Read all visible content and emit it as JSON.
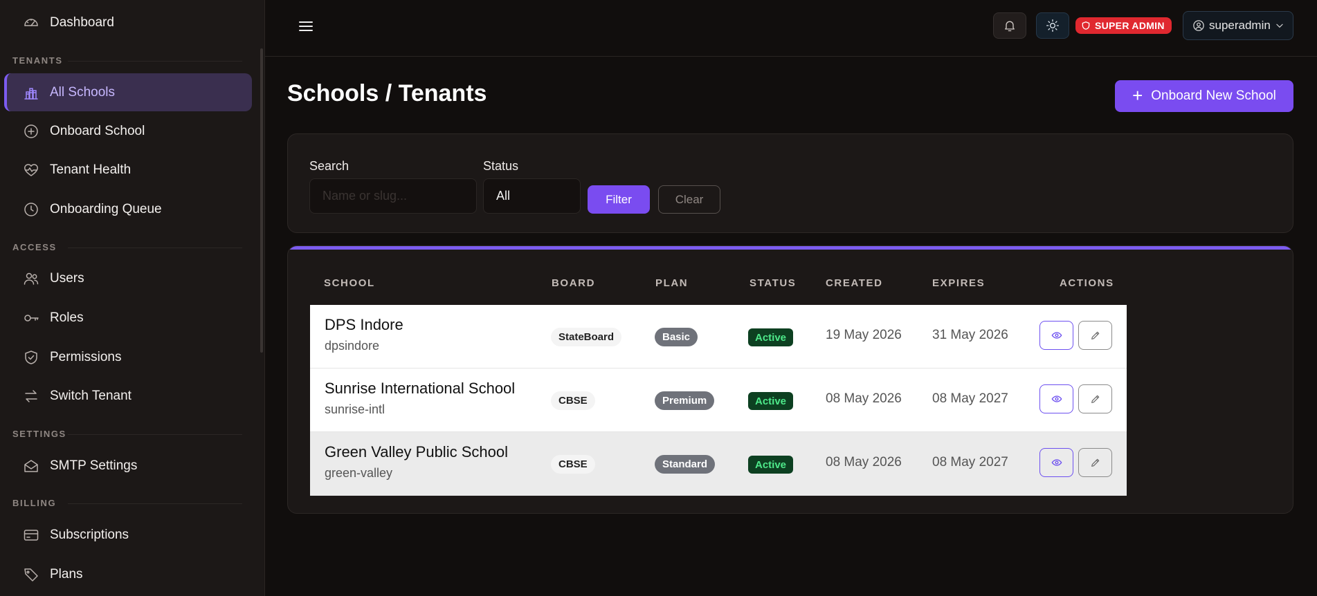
{
  "sidebar": {
    "top_item": {
      "label": "Dashboard",
      "icon": "speedometer-icon"
    },
    "sections": {
      "tenants": {
        "title": "TENANTS",
        "items": [
          {
            "label": "All Schools",
            "icon": "building-chart-icon",
            "active": true
          },
          {
            "label": "Onboard School",
            "icon": "plus-circle-icon"
          },
          {
            "label": "Tenant Health",
            "icon": "heart-pulse-icon"
          },
          {
            "label": "Onboarding Queue",
            "icon": "clock-icon"
          }
        ]
      },
      "access": {
        "title": "ACCESS",
        "items": [
          {
            "label": "Users",
            "icon": "users-icon"
          },
          {
            "label": "Roles",
            "icon": "key-icon"
          },
          {
            "label": "Permissions",
            "icon": "shield-check-icon"
          },
          {
            "label": "Switch Tenant",
            "icon": "arrows-swap-icon"
          }
        ]
      },
      "settings": {
        "title": "SETTINGS",
        "items": [
          {
            "label": "SMTP Settings",
            "icon": "envelope-icon"
          }
        ]
      },
      "billing": {
        "title": "BILLING",
        "items": [
          {
            "label": "Subscriptions",
            "icon": "credit-card-icon"
          },
          {
            "label": "Plans",
            "icon": "tags-icon"
          }
        ]
      }
    }
  },
  "topbar": {
    "role_badge": "SUPER ADMIN",
    "username": "superadmin",
    "accent_color": "#7a4cf0",
    "badge_color": "#e0282f"
  },
  "page": {
    "title": "Schools / Tenants",
    "onboard_button": "Onboard New School"
  },
  "filters": {
    "search_label": "Search",
    "search_placeholder": "Name or slug...",
    "search_value": "",
    "status_label": "Status",
    "status_value": "All",
    "filter_button": "Filter",
    "clear_button": "Clear"
  },
  "table": {
    "headers": {
      "school": "SCHOOL",
      "board": "BOARD",
      "plan": "PLAN",
      "status": "STATUS",
      "created": "CREATED",
      "expires": "EXPIRES",
      "actions": "ACTIONS"
    },
    "rows": [
      {
        "name": "DPS Indore",
        "slug": "dpsindore",
        "board": "StateBoard",
        "plan": "Basic",
        "status": "Active",
        "created": "19 May 2026",
        "expires": "31 May 2026"
      },
      {
        "name": "Sunrise International School",
        "slug": "sunrise-intl",
        "board": "CBSE",
        "plan": "Premium",
        "status": "Active",
        "created": "08 May 2026",
        "expires": "08 May 2027"
      },
      {
        "name": "Green Valley Public School",
        "slug": "green-valley",
        "board": "CBSE",
        "plan": "Standard",
        "status": "Active",
        "created": "08 May 2026",
        "expires": "08 May 2027"
      }
    ]
  }
}
